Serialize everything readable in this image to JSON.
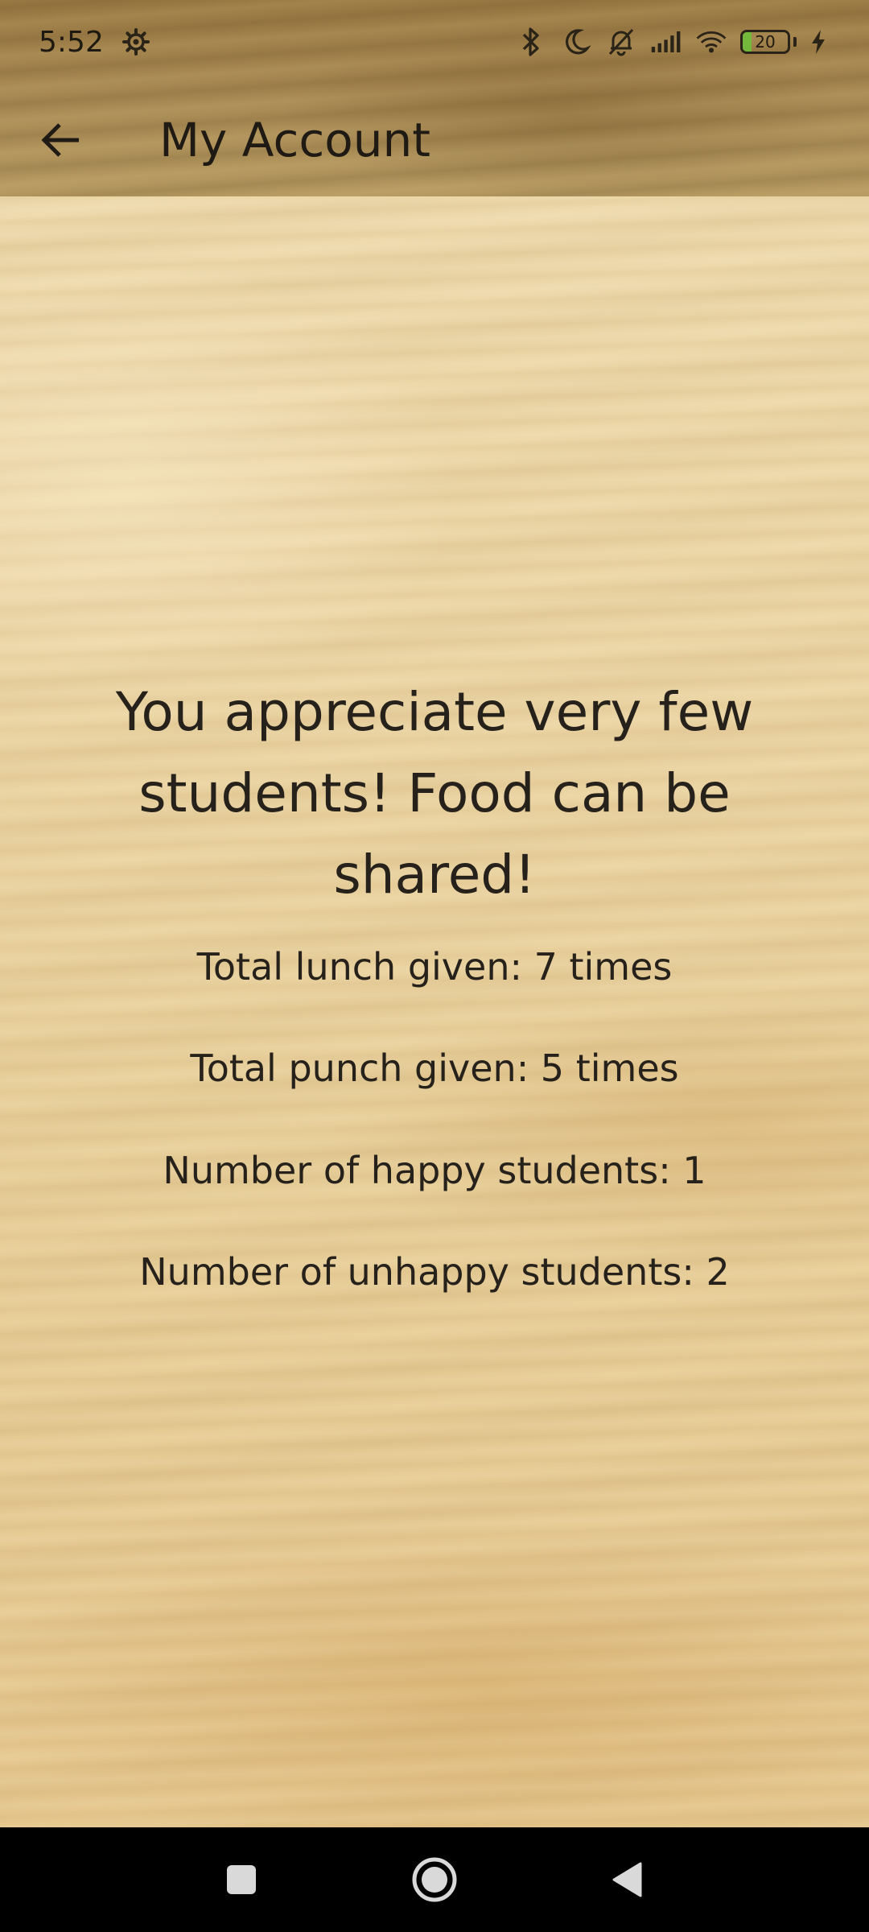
{
  "status_bar": {
    "time": "5:52",
    "battery_level": "20",
    "battery_fraction": 0.2,
    "icons": [
      "settings-gear-icon",
      "bluetooth-icon",
      "moon-icon",
      "bell-off-icon",
      "signal-icon",
      "wifi-icon",
      "battery-icon",
      "charging-bolt-icon"
    ]
  },
  "header": {
    "title": "My Account",
    "back_icon": "arrow-left-icon"
  },
  "main": {
    "headline": "You appreciate very few students! Food can be shared!",
    "stats": [
      "Total lunch given: 7 times",
      "Total punch given: 5 times",
      "Number of happy students: 1",
      "Number of unhappy students: 2"
    ]
  },
  "nav_bar": {
    "icons": [
      "recents-square-icon",
      "home-circle-icon",
      "back-triangle-icon"
    ]
  },
  "colors": {
    "battery_green": "#6fbf3a",
    "text": "#26221b",
    "nav_background": "#000000"
  }
}
